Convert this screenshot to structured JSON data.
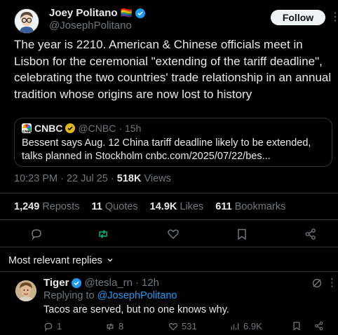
{
  "author": {
    "name": "Joey Politano",
    "flag_emoji": "🏳️‍🌈",
    "handle": "@JosephPolitano",
    "verified_icon": "verified-badge-icon"
  },
  "header": {
    "follow_label": "Follow",
    "more_icon": "more-horizontal-icon"
  },
  "tweet": {
    "text": "The year is 2210. American & Chinese officials meet in Lisbon for the ceremonial \"extending of the tariff deadline\", celebrating the two countries' trade relationship in an annual tradition whose origins are now lost to history"
  },
  "quote": {
    "source_name": "CNBC",
    "handle": "@CNBC",
    "separator": "·",
    "age": "15h",
    "text": "Bessent says Aug. 12 China tariff deadline likely to be extended, talks planned in Stockholm cnbc.com/2025/07/22/bes...",
    "badge_color": "#e2b719"
  },
  "meta": {
    "time": "10:23 PM",
    "separator1": "·",
    "date": "22 Jul 25",
    "separator2": "·",
    "views_count": "518K",
    "views_label": "Views"
  },
  "stats": [
    {
      "count": "1,249",
      "label": "Reposts"
    },
    {
      "count": "11",
      "label": "Quotes"
    },
    {
      "count": "14.9K",
      "label": "Likes"
    },
    {
      "count": "611",
      "label": "Bookmarks"
    }
  ],
  "actions": {
    "reply_icon": "reply-icon",
    "repost_icon": "repost-icon",
    "repost_color": "#00ba7c",
    "like_icon": "heart-icon",
    "bookmark_icon": "bookmark-icon",
    "share_icon": "share-icon"
  },
  "replies_header": {
    "label": "Most relevant replies",
    "icon": "chevron-down-icon"
  },
  "reply": {
    "name": "Tiger",
    "handle": "@tesla_rn",
    "separator": "·",
    "age": "12h",
    "replying_prefix": "Replying to",
    "replying_handle": "@JosephPolitano",
    "text": "Tacos are served, but no one knows why.",
    "counts": {
      "replies": "1",
      "reposts": "8",
      "likes": "531",
      "views": "6.9K"
    }
  },
  "colors": {
    "accent": "#1d9bf0",
    "text": "#e7e9ea",
    "muted": "#71767b",
    "divider": "#2f3336"
  }
}
